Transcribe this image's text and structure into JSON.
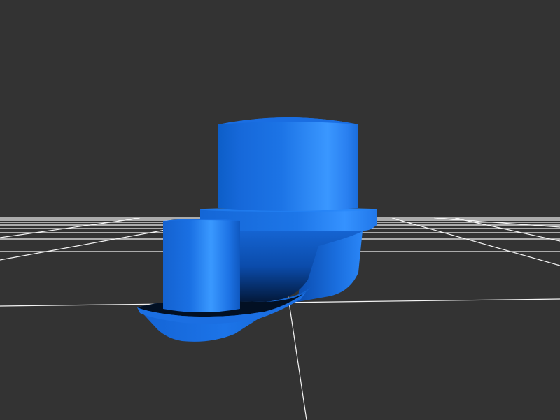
{
  "viewer": {
    "background_color": "#333333",
    "grid_color": "#ffffff",
    "model_color": "#1a75e8",
    "model_highlight_color": "#3d97ff",
    "model_shadow_color": "#062b58"
  },
  "model": {
    "parts": [
      "main-cylinder",
      "flange-ring",
      "side-post",
      "base-plate"
    ]
  }
}
